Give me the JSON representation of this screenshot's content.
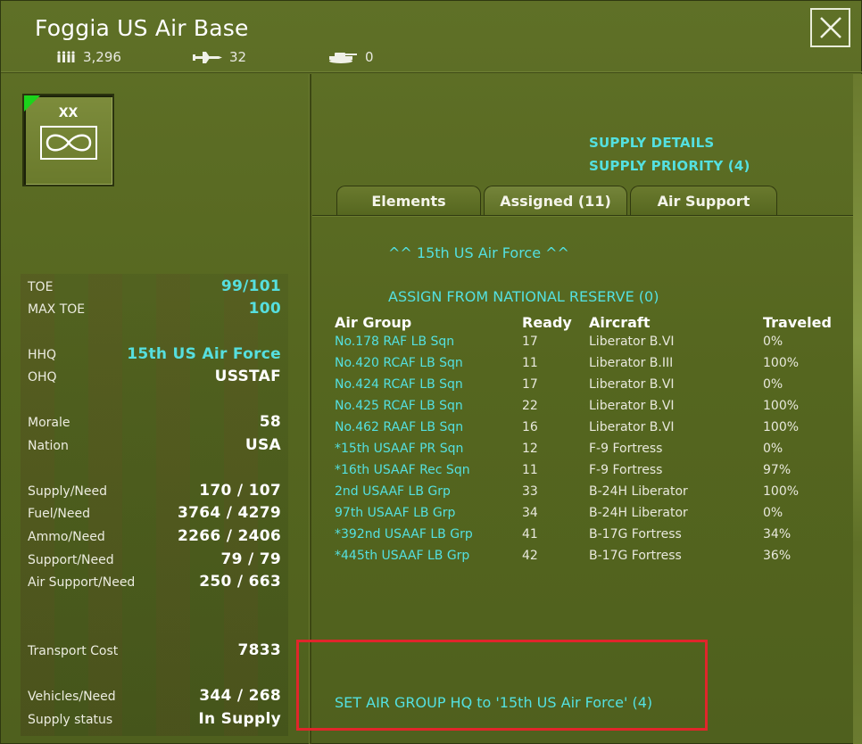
{
  "header": {
    "title": "Foggia US Air Base",
    "men": "3,296",
    "aircraft_count": "32",
    "vehicles": "0",
    "close_label": "✕"
  },
  "unit_counter": {
    "size_label": "XX",
    "symbol": "infinity-icon",
    "flag_color": "#1bd41b"
  },
  "stats": {
    "toe": {
      "label": "TOE",
      "value": "99/101"
    },
    "max_toe": {
      "label": "MAX TOE",
      "value": "100"
    },
    "hhq": {
      "label": "HHQ",
      "value": "15th US Air Force"
    },
    "ohq": {
      "label": "OHQ",
      "value": "USSTAF"
    },
    "morale": {
      "label": "Morale",
      "value": "58"
    },
    "nation": {
      "label": "Nation",
      "value": "USA"
    },
    "supply": {
      "label": "Supply/Need",
      "value": "170 / 107"
    },
    "fuel": {
      "label": "Fuel/Need",
      "value": "3764 / 4279"
    },
    "ammo": {
      "label": "Ammo/Need",
      "value": "2266 / 2406"
    },
    "support": {
      "label": "Support/Need",
      "value": "79 / 79"
    },
    "air_support": {
      "label": "Air Support/Need",
      "value": "250 / 663"
    },
    "transport": {
      "label": "Transport Cost",
      "value": "7833"
    },
    "vehicles": {
      "label": "Vehicles/Need",
      "value": "344 / 268"
    },
    "supply_status": {
      "label": "Supply status",
      "value": "In Supply"
    }
  },
  "links": {
    "supply_details": "SUPPLY DETAILS",
    "supply_priority": "SUPPLY PRIORITY (4)"
  },
  "tabs": [
    {
      "label": "Elements"
    },
    {
      "label": "Assigned (11)"
    },
    {
      "label": "Air Support"
    }
  ],
  "assigned": {
    "hq_line": "^^  15th US Air Force  ^^",
    "assign_reserve": "ASSIGN FROM NATIONAL RESERVE (0)",
    "columns": {
      "group": "Air Group",
      "ready": "Ready",
      "aircraft": "Aircraft",
      "traveled": "Traveled"
    },
    "rows": [
      {
        "group": "No.178 RAF LB Sqn",
        "ready": "17",
        "aircraft": "Liberator B.VI",
        "traveled": "0%"
      },
      {
        "group": "No.420 RCAF LB Sqn",
        "ready": "11",
        "aircraft": "Liberator B.III",
        "traveled": "100%"
      },
      {
        "group": "No.424 RCAF LB Sqn",
        "ready": "17",
        "aircraft": "Liberator B.VI",
        "traveled": "0%"
      },
      {
        "group": "No.425 RCAF LB Sqn",
        "ready": "22",
        "aircraft": "Liberator B.VI",
        "traveled": "100%"
      },
      {
        "group": "No.462 RAAF LB Sqn",
        "ready": "16",
        "aircraft": "Liberator B.VI",
        "traveled": "100%"
      },
      {
        "group": "*15th USAAF PR Sqn",
        "ready": "12",
        "aircraft": "F-9 Fortress",
        "traveled": "0%"
      },
      {
        "group": "*16th USAAF Rec Sqn",
        "ready": "11",
        "aircraft": "F-9 Fortress",
        "traveled": "97%"
      },
      {
        "group": "2nd USAAF LB Grp",
        "ready": "33",
        "aircraft": "B-24H Liberator",
        "traveled": "100%"
      },
      {
        "group": "97th USAAF LB Grp",
        "ready": "34",
        "aircraft": "B-24H Liberator",
        "traveled": "0%"
      },
      {
        "group": "*392nd USAAF LB Grp",
        "ready": "41",
        "aircraft": "B-17G Fortress",
        "traveled": "34%"
      },
      {
        "group": "*445th USAAF LB Grp",
        "ready": "42",
        "aircraft": "B-17G Fortress",
        "traveled": "36%"
      }
    ],
    "set_hq": "SET AIR GROUP HQ to '15th US Air Force' (4)"
  },
  "colors": {
    "link": "#54e0e0",
    "highlight": "#e0262b",
    "panel": "#5a6b24"
  }
}
